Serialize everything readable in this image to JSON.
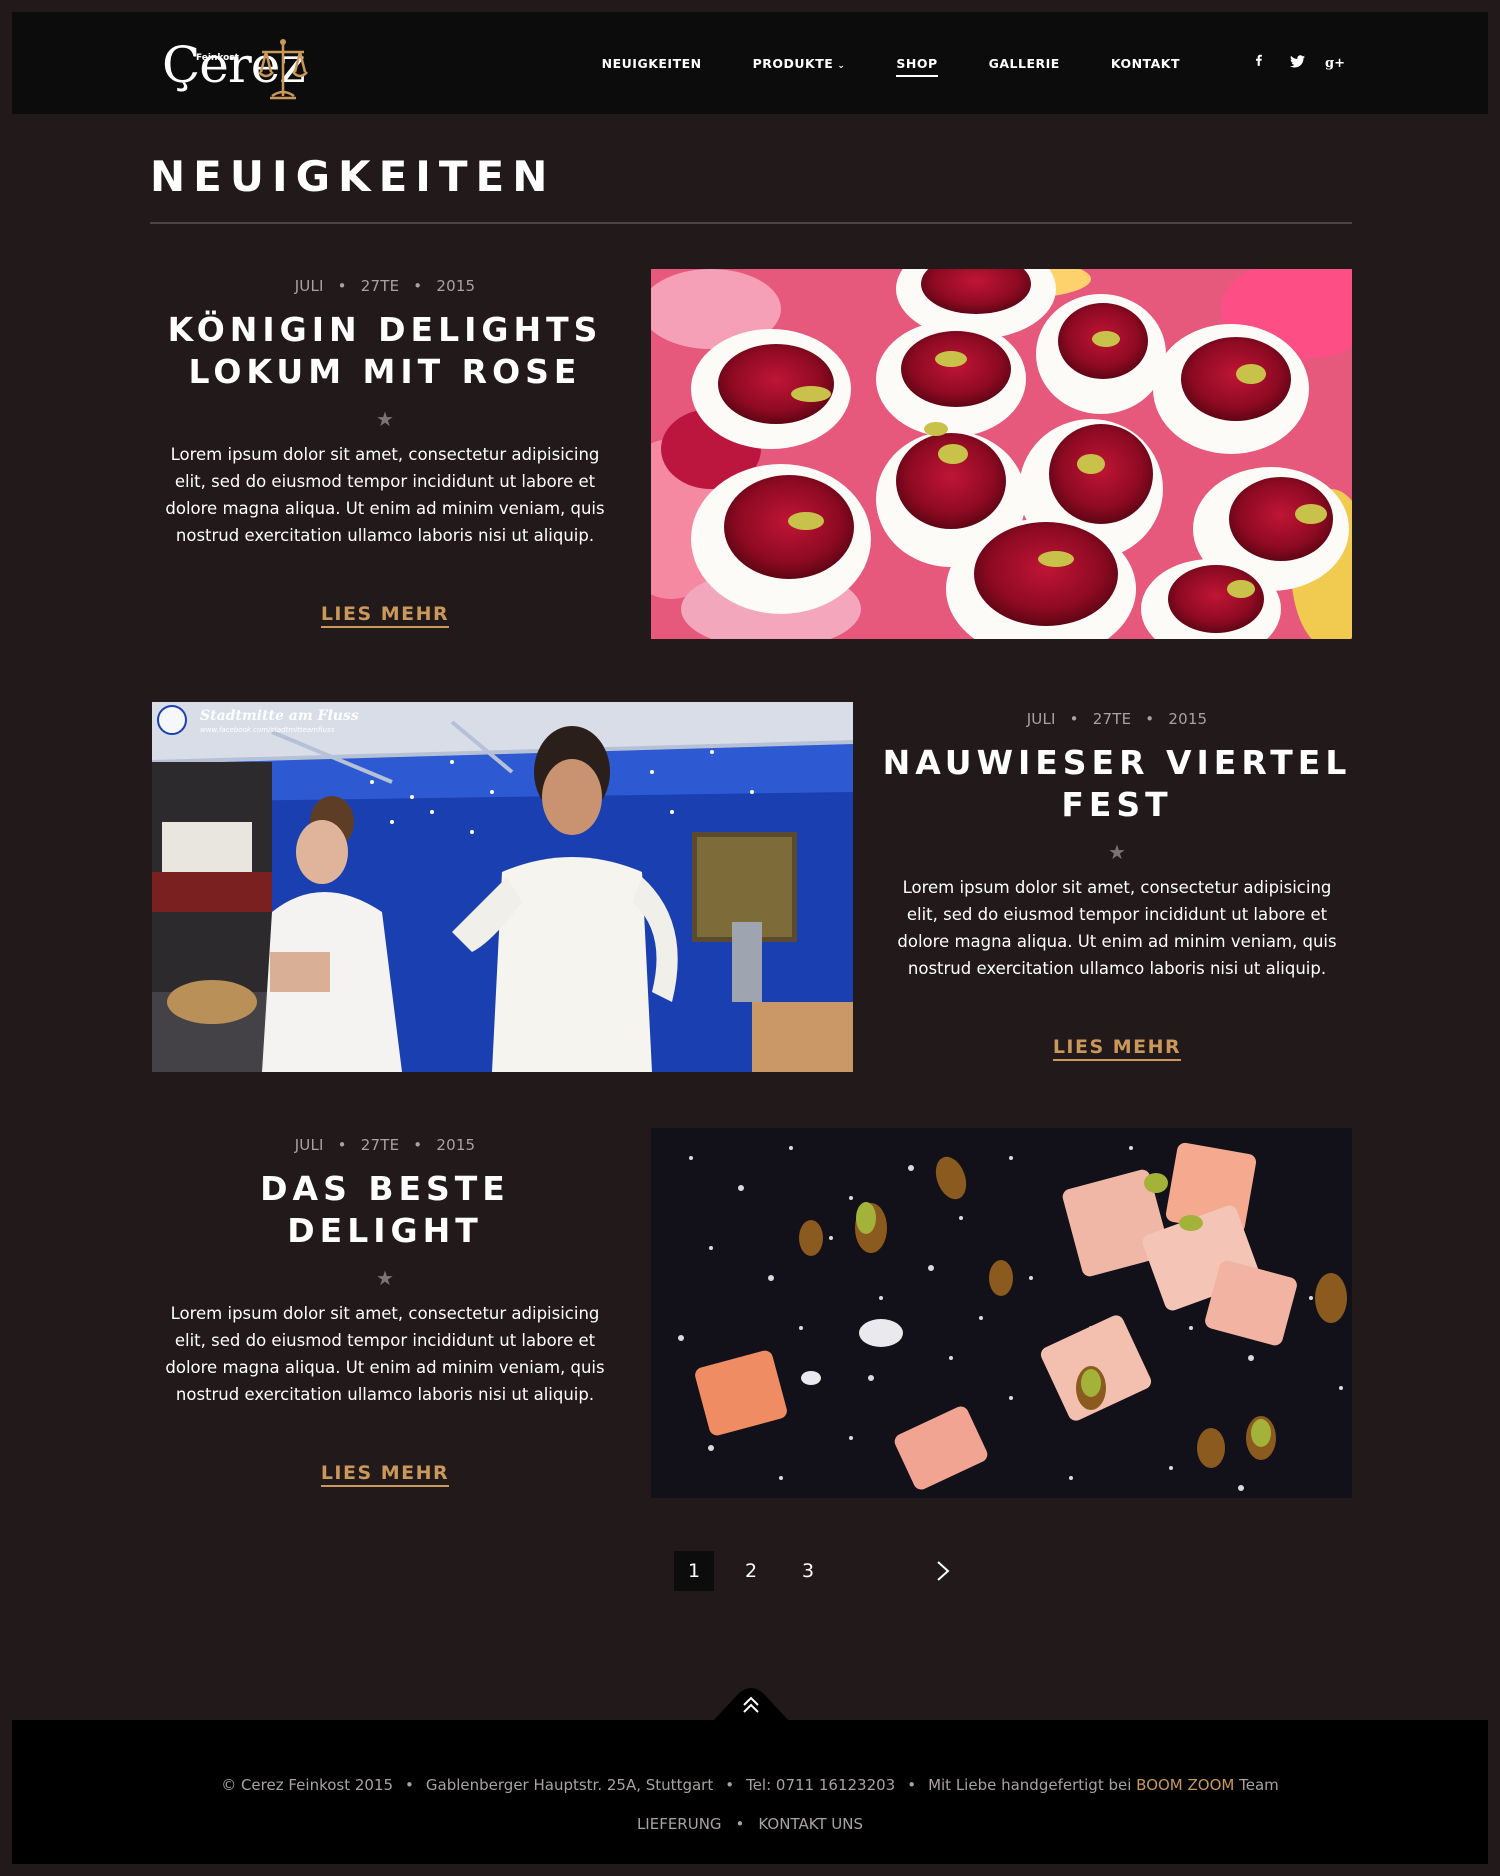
{
  "brand": {
    "small": "Feinkost",
    "name": "Çerez"
  },
  "nav": {
    "items": [
      "NEUIGKEITEN",
      "PRODUKTE",
      "SHOP",
      "GALLERIE",
      "KONTAKT"
    ],
    "active": "SHOP",
    "dropdown_icon": "chevron-down-icon"
  },
  "socials": [
    {
      "name": "facebook-icon",
      "glyph": "f"
    },
    {
      "name": "twitter-icon",
      "glyph": "t"
    },
    {
      "name": "google-plus-icon",
      "glyph": "g+"
    }
  ],
  "page": {
    "title": "NEUIGKEITEN"
  },
  "posts": [
    {
      "month": "JULI",
      "day": "27TE",
      "year": "2015",
      "title_line1": "KÖNIGIN DELIGHTS",
      "title_line2": "LOKUM MIT ROSE",
      "excerpt": "Lorem ipsum dolor sit amet, consectetur adipisicing elit, sed do eiusmod tempor incididunt ut labore et dolore magna aliqua. Ut enim ad minim veniam, quis nostrud exercitation ullamco laboris nisi ut aliquip.",
      "read_more": "LIES MEHR"
    },
    {
      "month": "JULI",
      "day": "27TE",
      "year": "2015",
      "title_line1": "NAUWIESER VIERTEL",
      "title_line2": "FEST",
      "excerpt": "Lorem ipsum dolor sit amet, consectetur adipisicing elit, sed do eiusmod tempor incididunt ut labore et dolore magna aliqua. Ut enim ad minim veniam, quis nostrud exercitation ullamco laboris nisi ut aliquip.",
      "read_more": "LIES MEHR",
      "image_overlay_title": "Stadtmitte am Fluss",
      "image_overlay_url": "www.facebook.com/stadtmitteamfluss"
    },
    {
      "month": "JULI",
      "day": "27TE",
      "year": "2015",
      "title_line1": "DAS BESTE",
      "title_line2": "DELIGHT",
      "excerpt": "Lorem ipsum dolor sit amet, consectetur adipisicing elit, sed do eiusmod tempor incididunt ut labore et dolore magna aliqua. Ut enim ad minim veniam, quis nostrud exercitation ullamco laboris nisi ut aliquip.",
      "read_more": "LIES MEHR"
    }
  ],
  "pagination": {
    "pages": [
      "1",
      "2",
      "3"
    ],
    "current": "1",
    "next_icon": "chevron-right-icon"
  },
  "footer": {
    "copyright": "© Cerez Feinkost 2015",
    "address": "Gablenberger Hauptstr. 25A, Stuttgart",
    "phone": "Tel: 0711 16123203",
    "credit_prefix": "Mit Liebe handgefertigt bei",
    "credit_brand": "BOOM ZOOM",
    "credit_suffix": "Team",
    "links": [
      "LIEFERUNG",
      "KONTAKT UNS"
    ]
  },
  "colors": {
    "background": "#221a1a",
    "header": "#0d0c0c",
    "accent": "#c9985a",
    "footer": "#000000"
  }
}
